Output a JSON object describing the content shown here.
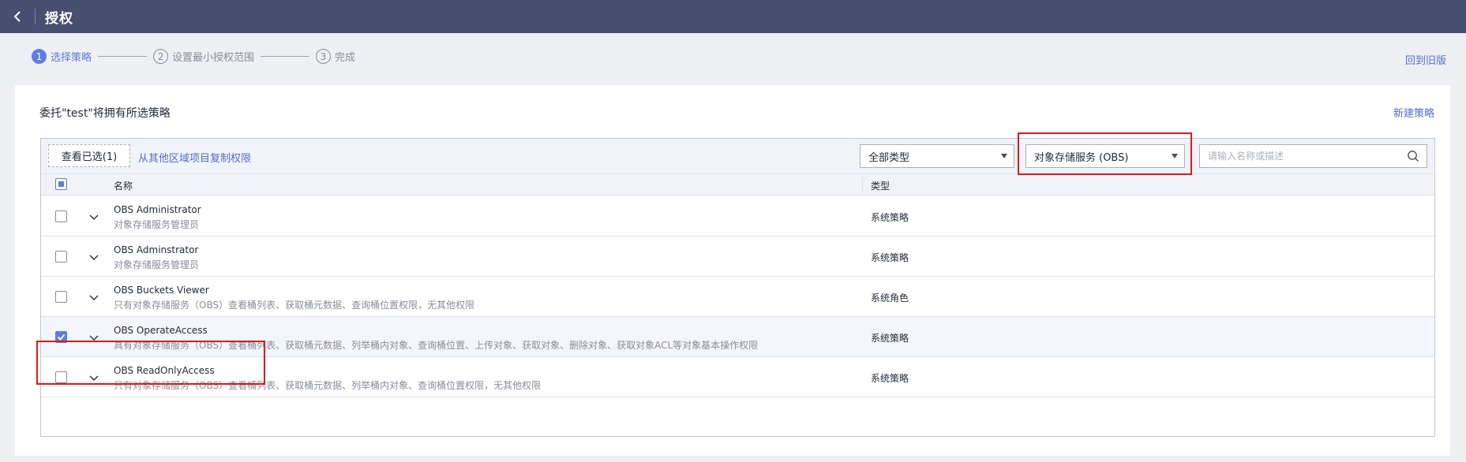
{
  "header": {
    "title": "授权"
  },
  "steps": [
    {
      "num": "1",
      "label": "选择策略"
    },
    {
      "num": "2",
      "label": "设置最小授权范围"
    },
    {
      "num": "3",
      "label": "完成"
    }
  ],
  "old_version_link": "回到旧版",
  "card": {
    "description": "委托\"test\"将拥有所选策略",
    "new_policy": "新建策略"
  },
  "toolbar": {
    "view_selected": "查看已选(1)",
    "copy_link": "从其他区域项目复制权限",
    "type_select": "全部类型",
    "service_select": "对象存储服务 (OBS)",
    "search_placeholder": "请输入名称或描述"
  },
  "table": {
    "col_name": "名称",
    "col_type": "类型",
    "rows": [
      {
        "name": "OBS Administrator",
        "desc": "对象存储服务管理员",
        "type": "系统策略",
        "checked": false
      },
      {
        "name": "OBS Adminstrator",
        "desc": "对象存储服务管理员",
        "type": "系统策略",
        "checked": false
      },
      {
        "name": "OBS Buckets Viewer",
        "desc": "只有对象存储服务（OBS）查看桶列表、获取桶元数据、查询桶位置权限，无其他权限",
        "type": "系统角色",
        "checked": false
      },
      {
        "name": "OBS OperateAccess",
        "desc": "具有对象存储服务（OBS）查看桶列表、获取桶元数据、列举桶内对象、查询桶位置、上传对象、获取对象、删除对象、获取对象ACL等对象基本操作权限",
        "type": "系统策略",
        "checked": true
      },
      {
        "name": "OBS ReadOnlyAccess",
        "desc": "只有对象存储服务（OBS）查看桶列表、获取桶元数据、列举桶内对象、查询桶位置权限，无其他权限",
        "type": "系统策略",
        "checked": false
      }
    ]
  },
  "colors": {
    "topbar": "#474f71",
    "accent": "#5e7ce0",
    "link": "#526ecc",
    "highlight": "#e0181c"
  }
}
